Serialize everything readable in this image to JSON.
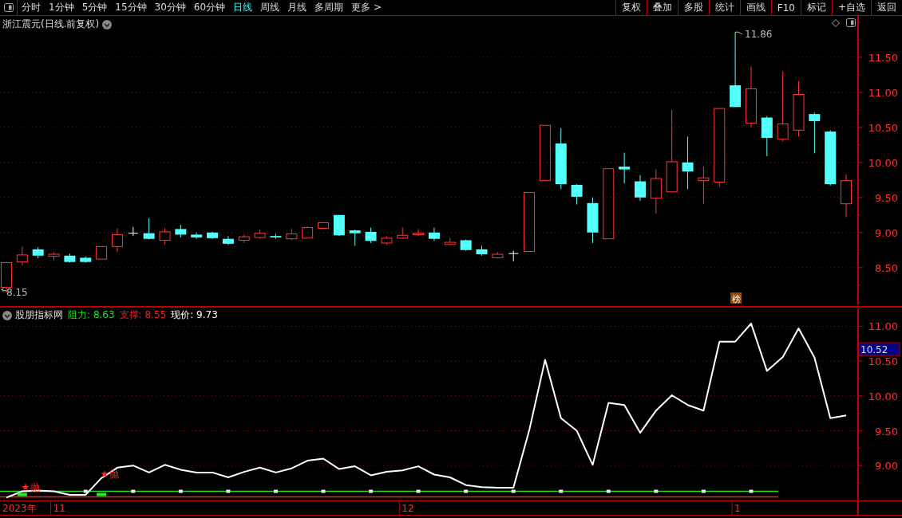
{
  "toolbar": {
    "periods": [
      {
        "label": "分时",
        "selected": false
      },
      {
        "label": "1分钟",
        "selected": false
      },
      {
        "label": "5分钟",
        "selected": false
      },
      {
        "label": "15分钟",
        "selected": false
      },
      {
        "label": "30分钟",
        "selected": false
      },
      {
        "label": "60分钟",
        "selected": false
      },
      {
        "label": "日线",
        "selected": true
      },
      {
        "label": "周线",
        "selected": false
      },
      {
        "label": "月线",
        "selected": false
      },
      {
        "label": "多周期",
        "selected": false
      },
      {
        "label": "更多 >",
        "selected": false
      }
    ],
    "actions": [
      "复权",
      "叠加",
      "多股",
      "统计",
      "画线",
      "F10",
      "标记",
      "+自选",
      "返回"
    ]
  },
  "price_chart": {
    "title": "浙江震元(日线.前复权)",
    "chart_data": {
      "type": "candlestick",
      "grid": true,
      "ylim": [
        7.94,
        12.09
      ],
      "yticks": [
        {
          "value": 8.5,
          "label": "8.50"
        },
        {
          "value": 9,
          "label": "9.00"
        },
        {
          "value": 9.5,
          "label": "9.50"
        },
        {
          "value": 10,
          "label": "10.00"
        },
        {
          "value": 10.5,
          "label": "10.50"
        },
        {
          "value": 11,
          "label": "11.00"
        },
        {
          "value": 11.5,
          "label": "11.50"
        }
      ],
      "ohlc": [
        [
          8.22,
          8.58,
          8.15,
          8.57
        ],
        [
          8.58,
          8.8,
          8.53,
          8.68
        ],
        [
          8.76,
          8.79,
          8.63,
          8.67
        ],
        [
          8.66,
          8.72,
          8.6,
          8.69
        ],
        [
          8.67,
          8.7,
          8.57,
          8.58
        ],
        [
          8.64,
          8.66,
          8.57,
          8.58
        ],
        [
          8.62,
          8.8,
          8.62,
          8.8
        ],
        [
          8.8,
          9.06,
          8.72,
          8.97
        ],
        [
          8.99,
          9.08,
          8.95,
          8.99
        ],
        [
          8.99,
          9.2,
          8.9,
          8.91
        ],
        [
          8.89,
          9.06,
          8.83,
          9.01
        ],
        [
          9.05,
          9.11,
          8.93,
          8.97
        ],
        [
          8.97,
          9.0,
          8.91,
          8.93
        ],
        [
          9.0,
          9.01,
          8.91,
          8.92
        ],
        [
          8.91,
          8.95,
          8.82,
          8.84
        ],
        [
          8.89,
          8.97,
          8.85,
          8.94
        ],
        [
          8.93,
          9.04,
          8.91,
          8.99
        ],
        [
          8.95,
          8.98,
          8.91,
          8.93
        ],
        [
          8.91,
          9.05,
          8.89,
          8.98
        ],
        [
          8.92,
          9.09,
          8.92,
          9.07
        ],
        [
          9.06,
          9.15,
          9.05,
          9.14
        ],
        [
          9.25,
          9.25,
          8.95,
          8.96
        ],
        [
          9.03,
          9.04,
          8.81,
          8.99
        ],
        [
          9.01,
          9.07,
          8.85,
          8.88
        ],
        [
          8.85,
          8.95,
          8.82,
          8.92
        ],
        [
          8.92,
          9.07,
          8.91,
          8.96
        ],
        [
          8.97,
          9.05,
          8.95,
          8.99
        ],
        [
          9.0,
          9.07,
          8.88,
          8.91
        ],
        [
          8.83,
          8.92,
          8.82,
          8.86
        ],
        [
          8.89,
          8.9,
          8.74,
          8.75
        ],
        [
          8.76,
          8.81,
          8.67,
          8.69
        ],
        [
          8.64,
          8.72,
          8.63,
          8.69
        ],
        [
          8.7,
          8.74,
          8.59,
          8.7
        ],
        [
          8.73,
          9.57,
          8.73,
          9.57
        ],
        [
          9.74,
          10.53,
          9.73,
          10.53
        ],
        [
          10.27,
          10.49,
          9.62,
          9.69
        ],
        [
          9.68,
          9.69,
          9.4,
          9.51
        ],
        [
          9.42,
          9.5,
          8.85,
          9.0
        ],
        [
          8.91,
          9.91,
          8.91,
          9.91
        ],
        [
          9.94,
          10.14,
          9.7,
          9.9
        ],
        [
          9.73,
          9.82,
          9.45,
          9.5
        ],
        [
          9.49,
          9.9,
          9.27,
          9.77
        ],
        [
          9.58,
          10.75,
          9.58,
          10.01
        ],
        [
          10.0,
          10.37,
          9.62,
          9.87
        ],
        [
          9.74,
          9.94,
          9.41,
          9.78
        ],
        [
          9.72,
          10.77,
          9.65,
          10.77
        ],
        [
          11.1,
          11.86,
          10.79,
          10.79
        ],
        [
          10.56,
          11.37,
          10.5,
          11.05
        ],
        [
          10.64,
          10.66,
          10.09,
          10.35
        ],
        [
          10.33,
          11.3,
          10.3,
          10.55
        ],
        [
          10.46,
          11.16,
          10.37,
          10.97
        ],
        [
          10.69,
          10.71,
          10.13,
          10.59
        ],
        [
          10.44,
          10.46,
          9.67,
          9.69
        ],
        [
          9.41,
          9.83,
          9.22,
          9.74
        ]
      ],
      "annotations": [
        "11.86",
        "8.15",
        "榜"
      ]
    }
  },
  "indicator": {
    "name": "股朋指标网",
    "readings": [
      {
        "label": "阻力:",
        "value": "8.63",
        "color": "#22dd22"
      },
      {
        "label": "支撑:",
        "value": "8.55",
        "color": "#ee2222"
      },
      {
        "label": "现价:",
        "value": "9.73",
        "color": "#ffffff"
      }
    ],
    "cursor_value": "10.52",
    "chart_data": {
      "type": "line",
      "grid": true,
      "ylim": [
        8.51,
        11.28
      ],
      "yticks": [
        {
          "value": 9,
          "label": "9.00"
        },
        {
          "value": 9.5,
          "label": "9.50"
        },
        {
          "value": 10,
          "label": "10.00"
        },
        {
          "value": 10.5,
          "label": "10.50"
        },
        {
          "value": 11,
          "label": "11.00"
        }
      ],
      "series": [
        {
          "color": "#ffffff",
          "values": [
            8.54,
            8.63,
            8.64,
            8.63,
            8.58,
            8.58,
            8.82,
            8.97,
            9.0,
            8.9,
            9.01,
            8.94,
            8.9,
            8.9,
            8.83,
            8.91,
            8.97,
            8.9,
            8.96,
            9.07,
            9.1,
            8.95,
            8.99,
            8.86,
            8.91,
            8.93,
            8.99,
            8.87,
            8.83,
            8.72,
            8.69,
            8.68,
            8.68,
            9.51,
            10.52,
            9.68,
            9.5,
            9.01,
            9.9,
            9.87,
            9.47,
            9.79,
            10.01,
            9.87,
            9.79,
            10.78,
            10.78,
            11.04,
            10.36,
            10.56,
            10.97,
            10.55,
            9.68,
            9.72
          ]
        }
      ],
      "ref_lines": [
        {
          "axis": "y",
          "value": 8.63,
          "color": "#22dd22"
        },
        {
          "axis": "y",
          "value": 8.55,
          "color": "#ee2222"
        }
      ],
      "annotations": [
        "抛",
        "抛"
      ]
    }
  },
  "time_axis": {
    "labels": [
      "2023年",
      "11",
      "12",
      "1"
    ]
  }
}
